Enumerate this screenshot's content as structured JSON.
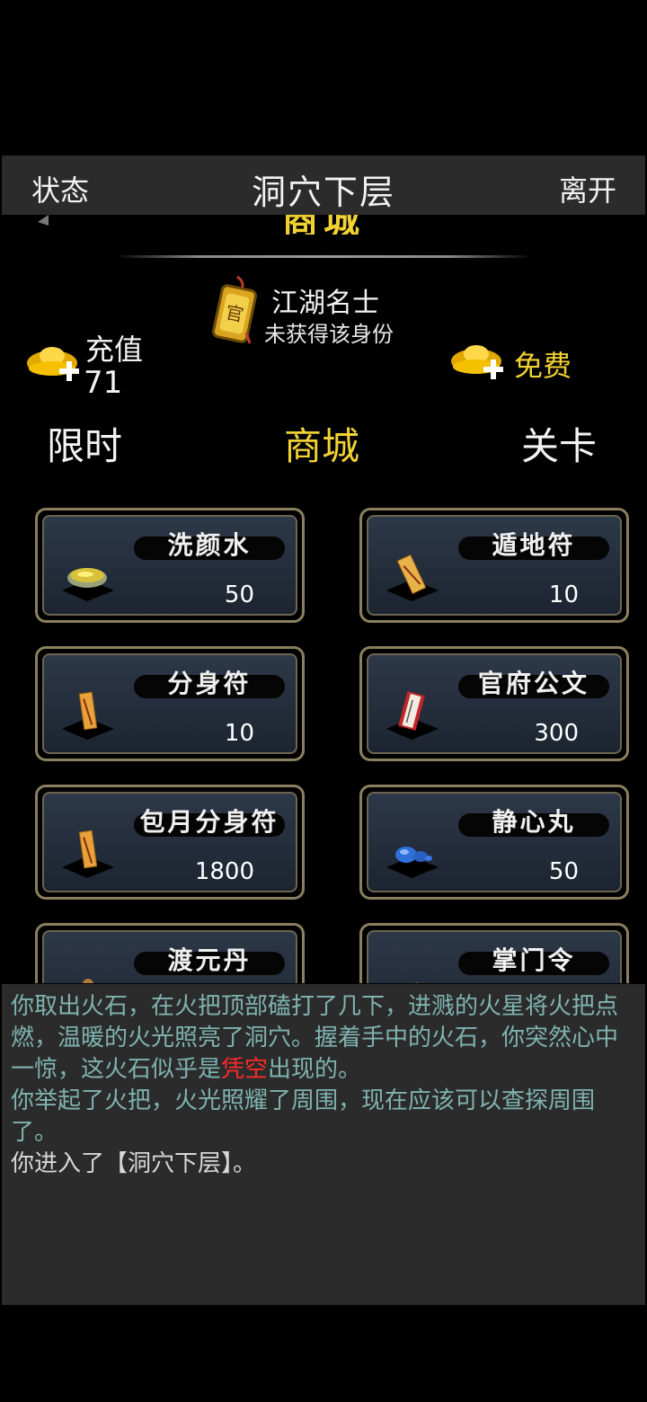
{
  "header": {
    "left": "状态",
    "title": "洞穴下层",
    "right": "离开"
  },
  "shop_title": "商城",
  "identity": {
    "name": "江湖名士",
    "status": "未获得该身份"
  },
  "currency": {
    "recharge_label": "充值",
    "amount": "71",
    "free_label": "免费"
  },
  "tabs": [
    {
      "label": "限时",
      "active": false
    },
    {
      "label": "商城",
      "active": true
    },
    {
      "label": "关卡",
      "active": false
    }
  ],
  "items": [
    {
      "name": "洗颜水",
      "price": "50",
      "icon": "bowl-icon"
    },
    {
      "name": "遁地符",
      "price": "10",
      "icon": "talisman-icon"
    },
    {
      "name": "分身符",
      "price": "10",
      "icon": "talisman-icon"
    },
    {
      "name": "官府公文",
      "price": "300",
      "icon": "document-icon"
    },
    {
      "name": "包月分身符",
      "price": "1800",
      "icon": "talisman-icon"
    },
    {
      "name": "静心丸",
      "price": "50",
      "icon": "pill-icon"
    },
    {
      "name": "渡元丹",
      "price": "",
      "icon": "gourd-icon"
    },
    {
      "name": "掌门令",
      "price": "",
      "icon": "token-icon"
    }
  ],
  "log": {
    "line1_a": "你取出火石，在火把顶部磕打了几下，进溅的火星将火把点燃，温暖的火光照亮了洞穴。握着手中的火石，你突然心中一惊，这火石似乎是",
    "line1_red": "凭空",
    "line1_b": "出现的。",
    "line2": "你举起了火把，火光照耀了周围，现在应该可以查探周围了。",
    "line3": "你进入了【洞穴下层】。"
  },
  "colors": {
    "accent": "#f2d233",
    "log_text": "#7fb3b0",
    "highlight": "#ff2a2a"
  }
}
